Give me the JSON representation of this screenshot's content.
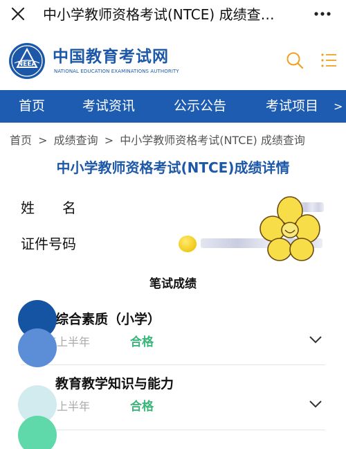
{
  "window": {
    "title": "中小学教师资格考试(NTCE) 成绩查…",
    "close_icon": "close-icon",
    "more_icon": "more-dots-icon"
  },
  "brand": {
    "name_cn": "中国教育考试网",
    "name_en": "NATIONAL EDUCATION EXAMINATIONS AUTHORITY",
    "logo_text": "NEEA",
    "accent_color": "#1d58a8",
    "icon_color": "#f0a020"
  },
  "nav": {
    "items": [
      "首页",
      "考试资讯",
      "公示公告",
      "考试项目"
    ],
    "more_label": ">",
    "background": "#1e5cb1"
  },
  "breadcrumb": {
    "items": [
      "首页",
      "成绩查询",
      "中小学教师资格考试(NTCE) 成绩查询"
    ],
    "separator": ">"
  },
  "page": {
    "title": "中小学教师资格考试(NTCE)成绩详情"
  },
  "candidate": {
    "name_label": "姓　　名",
    "id_label": "证件号码"
  },
  "written_exam": {
    "heading": "笔试成绩",
    "subjects": [
      {
        "title": "综合素质（小学）",
        "term": "年上半年",
        "result": "合格"
      },
      {
        "title": "教育教学知识与能力",
        "term": "年上半年",
        "result": "合格"
      }
    ],
    "pass_color": "#3bb67a"
  }
}
